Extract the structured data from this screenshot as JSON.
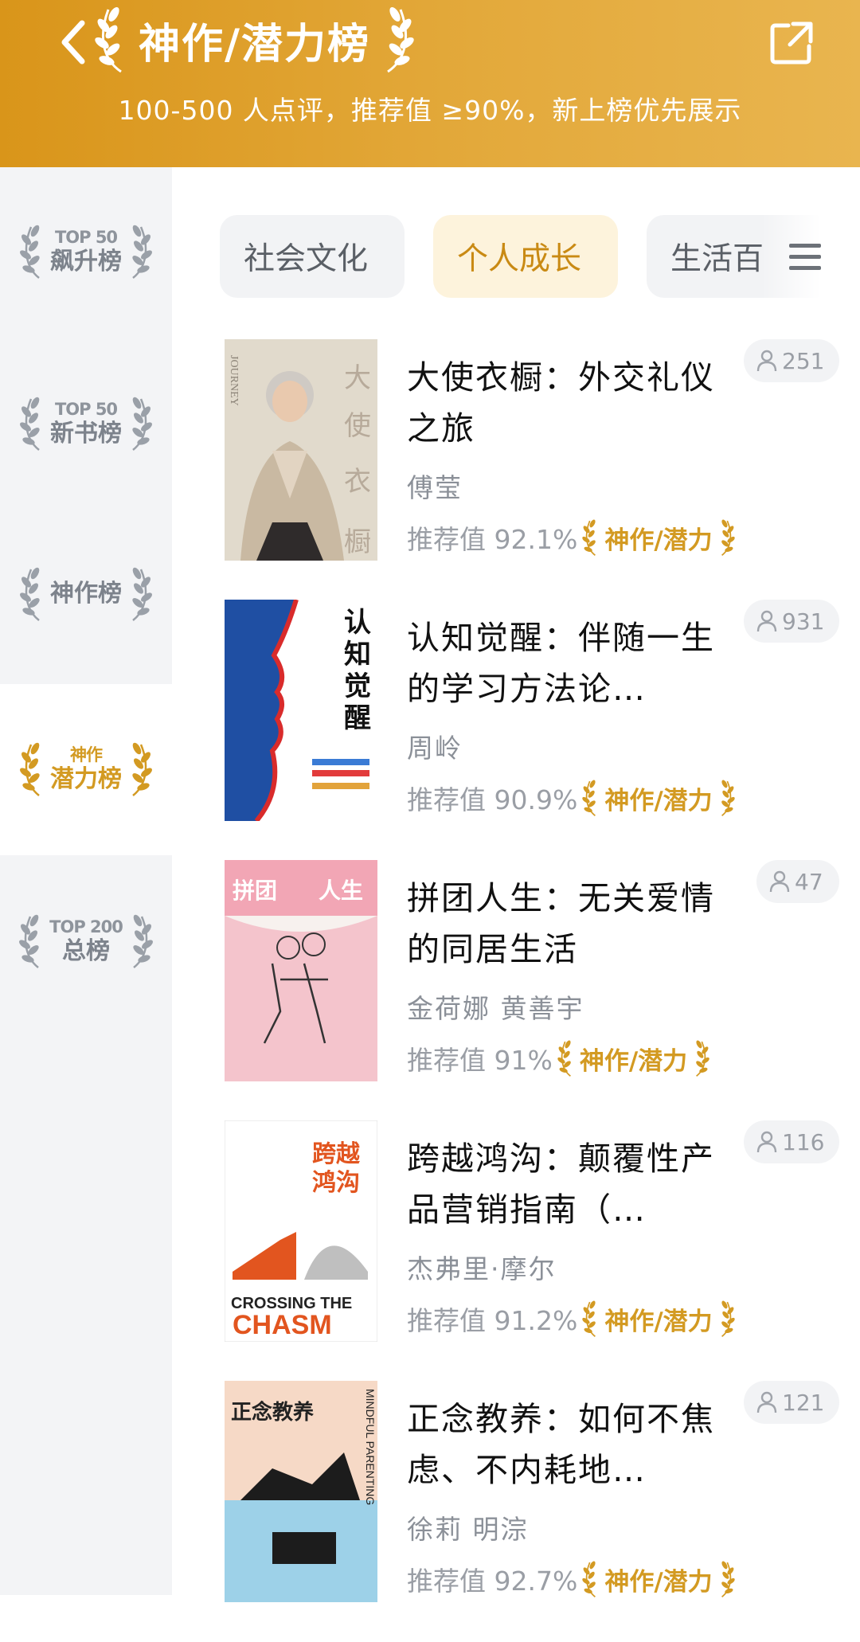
{
  "header": {
    "title": "神作/潜力榜",
    "subtitle": "100-500 人点评，推荐值 ≥90%，新上榜优先展示"
  },
  "sidebar": {
    "items": [
      {
        "top": "TOP 50",
        "main": "飙升榜",
        "active": false
      },
      {
        "top": "TOP 50",
        "main": "新书榜",
        "active": false
      },
      {
        "top": "",
        "main": "神作榜",
        "active": false
      },
      {
        "top": "神作",
        "main": "潜力榜",
        "active": true
      },
      {
        "top": "TOP 200",
        "main": "总榜",
        "active": false
      }
    ]
  },
  "tabs": [
    {
      "label": "社会文化",
      "active": false
    },
    {
      "label": "个人成长",
      "active": true
    },
    {
      "label": "生活百",
      "active": false
    }
  ],
  "badge_label": "神作/潜力",
  "rec_prefix": "推荐值",
  "books": [
    {
      "title": "大使衣橱：外交礼仪之旅",
      "author": "傅莹",
      "rec": "推荐值 92.1%",
      "count": "251",
      "cover": {
        "bg": "#e8e2d6",
        "title": "大使衣橱",
        "english": "JOURNEY"
      }
    },
    {
      "title": "认知觉醒：伴随一生的学习方法论…",
      "author": "周岭",
      "rec": "推荐值 90.9%",
      "count": "931",
      "cover": {
        "bg": "#ffffff",
        "title": "认知觉醒"
      }
    },
    {
      "title": "拼团人生：无关爱情的同居生活",
      "author": "金荷娜 黄善宇",
      "rec": "推荐值 91%",
      "count": "47",
      "cover": {
        "bg": "#f2a6b5",
        "title": "拼团 人生"
      }
    },
    {
      "title": "跨越鸿沟：颠覆性产品营销指南（…",
      "author": "杰弗里·摩尔",
      "rec": "推荐值 91.2%",
      "count": "116",
      "cover": {
        "bg": "#ffffff",
        "title": "跨越鸿沟",
        "english1": "CROSSING THE",
        "english2": "CHASM"
      }
    },
    {
      "title": "正念教养：如何不焦虑、不内耗地…",
      "author": "徐莉 明淙",
      "rec": "推荐值 92.7%",
      "count": "121",
      "cover": {
        "bg": "#f6d9c6",
        "title": "正念教养",
        "english": "MINDFUL PARENTING"
      }
    }
  ],
  "colors": {
    "accent": "#d39a22",
    "header_from": "#d9951a",
    "header_to": "#e9b54f"
  }
}
